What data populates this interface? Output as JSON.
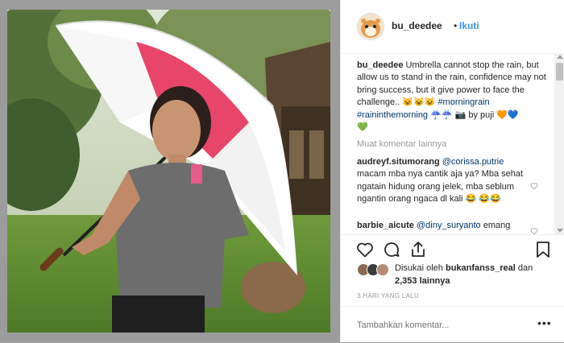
{
  "post": {
    "username": "bu_deedee",
    "separator": "•",
    "follow_label": "Ikuti"
  },
  "caption": {
    "username": "bu_deedee",
    "text": "Umbrella cannot stop the rain, but allow us to stand in the rain, confidence may not bring success, but it give power to face the challenge..",
    "emoji1": "😺😺😺",
    "tag1": "#morningrain",
    "tag2": "#raininthemorning",
    "emoji2": "☔☔ 📷",
    "by_text": "by puji",
    "hearts_line1": "💙",
    "hearts_line2": "💚",
    "heart_orange": "🧡"
  },
  "load_more_label": "Muat komentar lainnya",
  "comments": [
    {
      "username": "audreyf.situmorang",
      "mention": "@corissa.putrie",
      "text": "macam mba nya cantik aja ya? Mba sehat ngatain hidung orang jelek, mba seblum ngantin orang ngaca dl kali",
      "emoji": "😂",
      "emoji2": "😂😂"
    },
    {
      "username": "barbie_aicute",
      "mention": "@diny_suryanto",
      "text": "emang"
    }
  ],
  "likes": {
    "prefix": "Disukai oleh",
    "user": "bukanfanss_real",
    "and": "dan",
    "count": "2,353",
    "suffix": "lainnya"
  },
  "timestamp": "3 HARI YANG LALU",
  "add_comment": {
    "placeholder": "Tambahkan komentar...",
    "more": "•••"
  },
  "colors": {
    "link": "#3897f0",
    "hashtag": "#003569",
    "muted": "#999999",
    "text": "#262626"
  },
  "icons": [
    "heart-icon",
    "comment-icon",
    "share-icon",
    "bookmark-icon"
  ]
}
